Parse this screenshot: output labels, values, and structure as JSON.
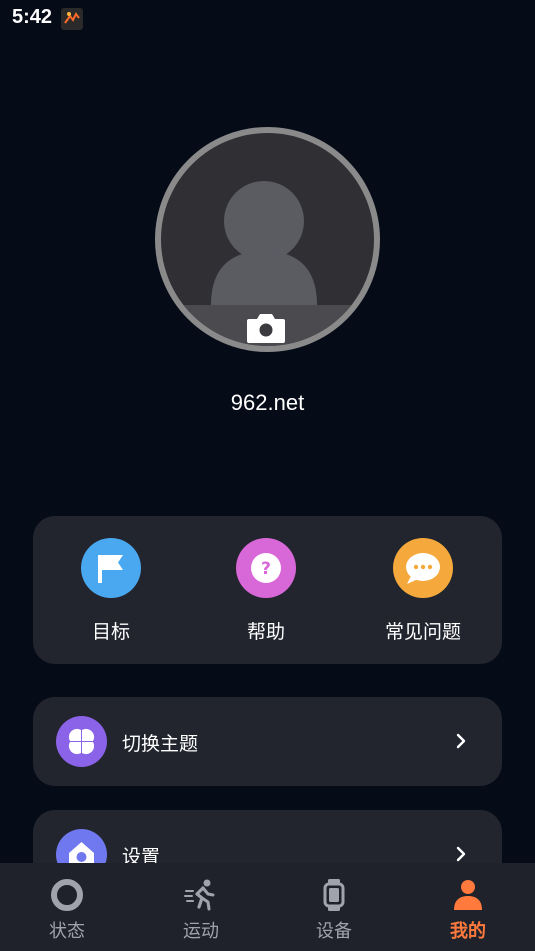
{
  "status_bar": {
    "time": "5:42"
  },
  "profile": {
    "username": "962.net"
  },
  "quick_actions": [
    {
      "label": "目标",
      "icon": "flag-icon",
      "color": "#4aa8f0"
    },
    {
      "label": "帮助",
      "icon": "question-icon",
      "color": "#d867d8"
    },
    {
      "label": "常见问题",
      "icon": "chat-bubble-icon",
      "color": "#f5a83c"
    }
  ],
  "menu_rows": [
    {
      "label": "切换主题",
      "icon": "theme-petals-icon",
      "color": "#8a63e8"
    },
    {
      "label": "设置",
      "icon": "settings-home-icon",
      "color": "#6f78ee"
    }
  ],
  "tabs": [
    {
      "label": "状态",
      "icon": "ring-icon",
      "active": false
    },
    {
      "label": "运动",
      "icon": "runner-icon",
      "active": false
    },
    {
      "label": "设备",
      "icon": "watch-icon",
      "active": false
    },
    {
      "label": "我的",
      "icon": "person-icon",
      "active": true
    }
  ],
  "colors": {
    "background": "#060b18",
    "card": "#22252e",
    "accent": "#ff7a3c",
    "tab_inactive": "#a0a3ab"
  }
}
